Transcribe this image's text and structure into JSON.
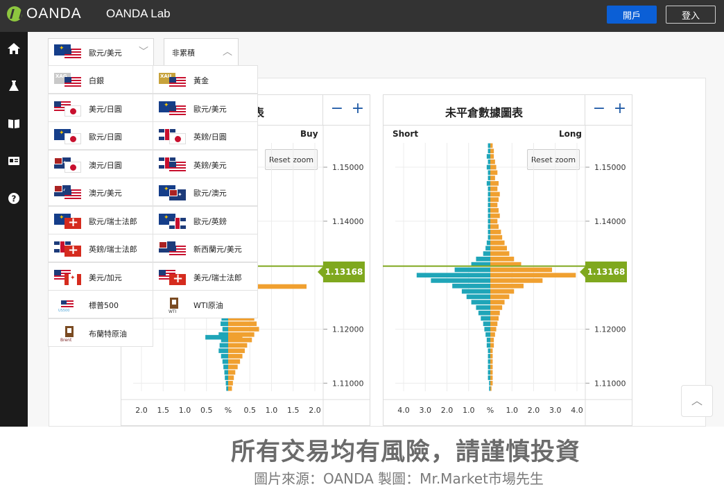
{
  "topbar": {
    "logo_text": "OANDA",
    "lab_text": "OANDA Lab",
    "open_account": "開戶",
    "login": "登入"
  },
  "sidenav": [
    "home-icon",
    "flask-icon",
    "book-icon",
    "id-card-icon",
    "help-icon"
  ],
  "selectors": {
    "instrument": "歐元/美元",
    "mode": "非累積"
  },
  "dropdown": {
    "items": [
      {
        "label": "白銀",
        "flags": [
          "xag",
          "us"
        ],
        "badge": "XAG"
      },
      {
        "label": "黃金",
        "flags": [
          "xau",
          "us"
        ],
        "badge": "XAU"
      },
      {
        "label": "美元/日圓",
        "flags": [
          "us",
          "jp"
        ]
      },
      {
        "label": "歐元/美元",
        "flags": [
          "eu",
          "us"
        ]
      },
      {
        "label": "歐元/日圓",
        "flags": [
          "eu",
          "jp"
        ]
      },
      {
        "label": "英鎊/日圓",
        "flags": [
          "gb",
          "jp"
        ]
      },
      {
        "label": "澳元/日圓",
        "flags": [
          "au",
          "jp"
        ]
      },
      {
        "label": "英鎊/美元",
        "flags": [
          "gb",
          "us"
        ]
      },
      {
        "label": "澳元/美元",
        "flags": [
          "au",
          "us"
        ]
      },
      {
        "label": "歐元/澳元",
        "flags": [
          "eu",
          "au"
        ]
      },
      {
        "label": "歐元/瑞士法郎",
        "flags": [
          "eu",
          "ch"
        ]
      },
      {
        "label": "歐元/英鎊",
        "flags": [
          "eu",
          "gb"
        ]
      },
      {
        "label": "英鎊/瑞士法郎",
        "flags": [
          "gb",
          "ch"
        ]
      },
      {
        "label": "新西蘭元/美元",
        "flags": [
          "nz",
          "us"
        ]
      },
      {
        "label": "美元/加元",
        "flags": [
          "us",
          "ca"
        ]
      },
      {
        "label": "美元/瑞士法郎",
        "flags": [
          "us",
          "ch"
        ]
      },
      {
        "label": "標普500",
        "icon": "us500",
        "icon_text": "US500"
      },
      {
        "label": "WTI原油",
        "icon": "oil-rig",
        "icon_text": "WTI"
      },
      {
        "label": "布蘭特原油",
        "icon": "oil-rig",
        "icon_text": "Brent"
      }
    ]
  },
  "panels": {
    "left": {
      "title_visible": "表",
      "right_label": "Buy",
      "reset_zoom": "Reset zoom",
      "zoom_out": "−",
      "zoom_in": "+"
    },
    "right": {
      "title": "未平倉數據圖表",
      "left_label": "Short",
      "right_label": "Long",
      "reset_zoom": "Reset zoom",
      "zoom_out": "−",
      "zoom_in": "+"
    }
  },
  "current_price": "1.13168",
  "chart_data": [
    {
      "type": "bar",
      "name": "left-orderbook-panel",
      "y_ticks": [
        "1.15000",
        "1.14000",
        "1.12000",
        "1.11000"
      ],
      "y_tick_values": [
        1.15,
        1.14,
        1.12,
        1.11
      ],
      "ylim": [
        1.1085,
        1.1545
      ],
      "x_ticks": [
        "2.0",
        "1.5",
        "1.0",
        "0.5",
        "%",
        "0.5",
        "1.0",
        "1.5",
        "2.0"
      ],
      "xlim": [
        -2.0,
        2.0
      ],
      "price_line": 1.13168,
      "bars": [
        {
          "y": 1.1279,
          "left": 0,
          "right": 1.65
        },
        {
          "y": 1.125,
          "left": 0.1,
          "right": 0.35
        },
        {
          "y": 1.124,
          "left": 0.12,
          "right": 0.45
        },
        {
          "y": 1.123,
          "left": 0.1,
          "right": 0.5
        },
        {
          "y": 1.122,
          "left": 0.14,
          "right": 0.55
        },
        {
          "y": 1.121,
          "left": 0.16,
          "right": 0.6
        },
        {
          "y": 1.12,
          "left": 0.12,
          "right": 0.65
        },
        {
          "y": 1.119,
          "left": 0.2,
          "right": 0.55
        },
        {
          "y": 1.1185,
          "left": 0.48,
          "right": 0.3
        },
        {
          "y": 1.118,
          "left": 0.15,
          "right": 0.5
        },
        {
          "y": 1.117,
          "left": 0.18,
          "right": 0.4
        },
        {
          "y": 1.116,
          "left": 0.2,
          "right": 0.35
        },
        {
          "y": 1.115,
          "left": 0.15,
          "right": 0.3
        },
        {
          "y": 1.114,
          "left": 0.12,
          "right": 0.25
        },
        {
          "y": 1.113,
          "left": 0.1,
          "right": 0.2
        },
        {
          "y": 1.112,
          "left": 0.08,
          "right": 0.15
        },
        {
          "y": 1.111,
          "left": 0.07,
          "right": 0.12
        },
        {
          "y": 1.11,
          "left": 0.05,
          "right": 0.1
        },
        {
          "y": 1.109,
          "left": 0.04,
          "right": 0.08
        }
      ]
    },
    {
      "type": "bar",
      "name": "open-positions",
      "title": "未平倉數據圖表",
      "y_ticks": [
        "1.15000",
        "1.14000",
        "1.12000",
        "1.11000"
      ],
      "y_tick_values": [
        1.15,
        1.14,
        1.12,
        1.11
      ],
      "ylim": [
        1.1085,
        1.1545
      ],
      "x_ticks": [
        "4.0",
        "3.0",
        "2.0",
        "1.0",
        "%",
        "1.0",
        "2.0",
        "3.0",
        "4.0"
      ],
      "xlim": [
        -4.0,
        4.0
      ],
      "price_line": 1.13168,
      "series_labels": [
        "Short",
        "Long"
      ],
      "bars": [
        {
          "y": 1.154,
          "short": 0.1,
          "long": 0.1
        },
        {
          "y": 1.153,
          "short": 0.1,
          "long": 0.15
        },
        {
          "y": 1.152,
          "short": 0.15,
          "long": 0.15
        },
        {
          "y": 1.151,
          "short": 0.1,
          "long": 0.2
        },
        {
          "y": 1.15,
          "short": 0.15,
          "long": 0.25
        },
        {
          "y": 1.149,
          "short": 0.1,
          "long": 0.3
        },
        {
          "y": 1.148,
          "short": 0.1,
          "long": 0.2
        },
        {
          "y": 1.147,
          "short": 0.15,
          "long": 0.35
        },
        {
          "y": 1.146,
          "short": 0.1,
          "long": 0.3
        },
        {
          "y": 1.145,
          "short": 0.1,
          "long": 0.4
        },
        {
          "y": 1.144,
          "short": 0.1,
          "long": 0.35
        },
        {
          "y": 1.143,
          "short": 0.1,
          "long": 0.3
        },
        {
          "y": 1.142,
          "short": 0.1,
          "long": 0.35
        },
        {
          "y": 1.141,
          "short": 0.1,
          "long": 0.4
        },
        {
          "y": 1.14,
          "short": 0.1,
          "long": 0.3
        },
        {
          "y": 1.139,
          "short": 0.1,
          "long": 0.35
        },
        {
          "y": 1.138,
          "short": 0.1,
          "long": 0.45
        },
        {
          "y": 1.137,
          "short": 0.1,
          "long": 0.5
        },
        {
          "y": 1.136,
          "short": 0.15,
          "long": 0.6
        },
        {
          "y": 1.135,
          "short": 0.2,
          "long": 0.7
        },
        {
          "y": 1.134,
          "short": 0.3,
          "long": 0.8
        },
        {
          "y": 1.133,
          "short": 0.6,
          "long": 1.0
        },
        {
          "y": 1.132,
          "short": 0.8,
          "long": 1.3
        },
        {
          "y": 1.131,
          "short": 1.5,
          "long": 2.6
        },
        {
          "y": 1.13,
          "short": 3.1,
          "long": 3.6
        },
        {
          "y": 1.129,
          "short": 2.5,
          "long": 2.2
        },
        {
          "y": 1.128,
          "short": 1.6,
          "long": 1.4
        },
        {
          "y": 1.127,
          "short": 1.2,
          "long": 1.0
        },
        {
          "y": 1.126,
          "short": 1.0,
          "long": 0.8
        },
        {
          "y": 1.125,
          "short": 0.8,
          "long": 0.6
        },
        {
          "y": 1.124,
          "short": 0.6,
          "long": 0.5
        },
        {
          "y": 1.123,
          "short": 0.5,
          "long": 0.4
        },
        {
          "y": 1.122,
          "short": 0.4,
          "long": 0.35
        },
        {
          "y": 1.121,
          "short": 0.3,
          "long": 0.3
        },
        {
          "y": 1.12,
          "short": 0.25,
          "long": 0.25
        },
        {
          "y": 1.119,
          "short": 0.2,
          "long": 0.2
        },
        {
          "y": 1.118,
          "short": 0.15,
          "long": 0.15
        },
        {
          "y": 1.117,
          "short": 0.15,
          "long": 0.15
        },
        {
          "y": 1.116,
          "short": 0.1,
          "long": 0.1
        },
        {
          "y": 1.115,
          "short": 0.1,
          "long": 0.1
        },
        {
          "y": 1.114,
          "short": 0.1,
          "long": 0.1
        },
        {
          "y": 1.113,
          "short": 0.1,
          "long": 0.1
        },
        {
          "y": 1.112,
          "short": 0.1,
          "long": 0.1
        },
        {
          "y": 1.111,
          "short": 0.1,
          "long": 0.1
        },
        {
          "y": 1.11,
          "short": 0.05,
          "long": 0.1
        },
        {
          "y": 1.109,
          "short": 0.05,
          "long": 0.05
        }
      ]
    }
  ],
  "colors": {
    "short": "#1fa5b8",
    "long": "#f0a030",
    "price_line": "#7fa81e",
    "accent": "#0b5fd6"
  },
  "footer": {
    "warning": "所有交易均有風險，請謹慎投資",
    "credit": "圖片來源：OANDA 製圖：Mr.Market市場先生"
  }
}
